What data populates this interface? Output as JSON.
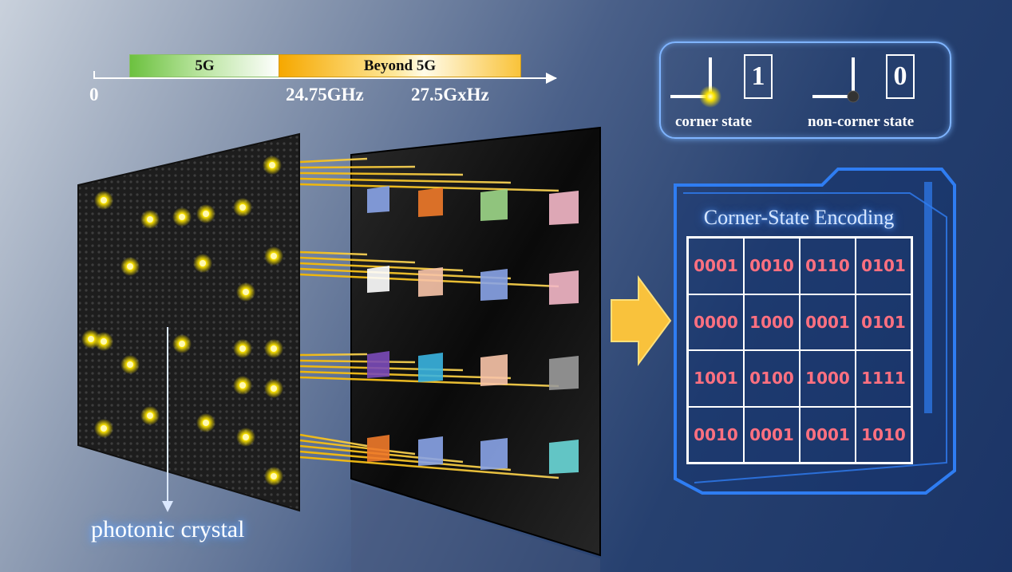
{
  "spectrum": {
    "band_5g": "5G",
    "band_beyond": "Beyond 5G",
    "tick_zero": "0",
    "tick_mid": "24.75GHz",
    "tick_high": "27.5GxHz"
  },
  "legend": {
    "corner_bit": "1",
    "corner_label": "corner state",
    "noncorner_bit": "0",
    "noncorner_label": "non-corner state"
  },
  "encoding": {
    "title": "Corner-State Encoding",
    "rows": [
      [
        "0001",
        "0010",
        "0110",
        "0101"
      ],
      [
        "0000",
        "1000",
        "0001",
        "0101"
      ],
      [
        "1001",
        "0100",
        "1000",
        "1111"
      ],
      [
        "0010",
        "0001",
        "0001",
        "1010"
      ]
    ]
  },
  "photonic_label": "photonic crystal",
  "colors": {
    "glow": "#ffe500",
    "beam": "#f5b800",
    "code_text": "#ff7080",
    "panel_border": "#2f7df2"
  }
}
